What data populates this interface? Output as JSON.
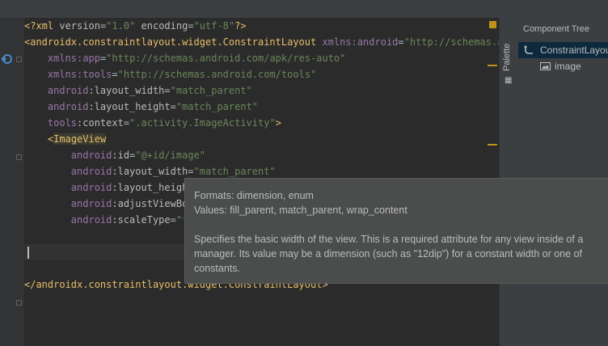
{
  "editor": {
    "lines": [
      [
        {
          "c": "t-pi",
          "t": "<?xml "
        },
        {
          "c": "t-attr",
          "t": "version"
        },
        {
          "c": "t-txt",
          "t": "="
        },
        {
          "c": "t-val",
          "t": "\"1.0\""
        },
        {
          "c": "t-txt",
          "t": " "
        },
        {
          "c": "t-attr",
          "t": "encoding"
        },
        {
          "c": "t-txt",
          "t": "="
        },
        {
          "c": "t-val",
          "t": "\"utf-8\""
        },
        {
          "c": "t-pi",
          "t": "?>"
        }
      ],
      [
        {
          "c": "t-tag",
          "t": "<androidx.constraintlayout.widget.ConstraintLayout "
        },
        {
          "c": "t-ns",
          "t": "xmlns:android"
        },
        {
          "c": "t-txt",
          "t": "="
        },
        {
          "c": "t-val",
          "t": "\"http://schemas.and"
        }
      ],
      [
        {
          "c": "t-txt",
          "t": "    "
        },
        {
          "c": "t-ns",
          "t": "xmlns:app"
        },
        {
          "c": "t-txt",
          "t": "="
        },
        {
          "c": "t-val",
          "t": "\"http://schemas.android.com/apk/res-auto\""
        }
      ],
      [
        {
          "c": "t-txt",
          "t": "    "
        },
        {
          "c": "t-ns",
          "t": "xmlns:tools"
        },
        {
          "c": "t-txt",
          "t": "="
        },
        {
          "c": "t-val",
          "t": "\"http://schemas.android.com/tools\""
        }
      ],
      [
        {
          "c": "t-txt",
          "t": "    "
        },
        {
          "c": "t-ns",
          "t": "android"
        },
        {
          "c": "t-attr",
          "t": ":layout_width"
        },
        {
          "c": "t-txt",
          "t": "="
        },
        {
          "c": "t-val",
          "t": "\"match_parent\""
        }
      ],
      [
        {
          "c": "t-txt",
          "t": "    "
        },
        {
          "c": "t-ns",
          "t": "android"
        },
        {
          "c": "t-attr",
          "t": ":layout_height"
        },
        {
          "c": "t-txt",
          "t": "="
        },
        {
          "c": "t-val",
          "t": "\"match_parent\""
        }
      ],
      [
        {
          "c": "t-txt",
          "t": "    "
        },
        {
          "c": "t-ns",
          "t": "tools"
        },
        {
          "c": "t-attr",
          "t": ":context"
        },
        {
          "c": "t-txt",
          "t": "="
        },
        {
          "c": "t-val",
          "t": "\".activity.ImageActivity\""
        },
        {
          "c": "t-tag",
          "t": ">"
        }
      ],
      [
        {
          "c": "t-txt",
          "t": "    "
        },
        {
          "c": "t-tag",
          "t": "<"
        },
        {
          "c": "t-tag t-hl",
          "t": "ImageView"
        }
      ],
      [
        {
          "c": "t-txt",
          "t": "        "
        },
        {
          "c": "t-ns",
          "t": "android"
        },
        {
          "c": "t-attr",
          "t": ":id"
        },
        {
          "c": "t-txt",
          "t": "="
        },
        {
          "c": "t-val",
          "t": "\"@+id/image\""
        }
      ],
      [
        {
          "c": "t-txt",
          "t": "        "
        },
        {
          "c": "t-ns",
          "t": "android"
        },
        {
          "c": "t-attr",
          "t": ":layout_width"
        },
        {
          "c": "t-txt",
          "t": "="
        },
        {
          "c": "t-val",
          "t": "\"match_parent\""
        }
      ],
      [
        {
          "c": "t-txt",
          "t": "        "
        },
        {
          "c": "t-ns",
          "t": "android"
        },
        {
          "c": "t-attr",
          "t": ":layout_heigh"
        }
      ],
      [
        {
          "c": "t-txt",
          "t": "        "
        },
        {
          "c": "t-ns",
          "t": "android"
        },
        {
          "c": "t-attr",
          "t": ":adjustViewBo"
        }
      ],
      [
        {
          "c": "t-txt",
          "t": "        "
        },
        {
          "c": "t-ns",
          "t": "android"
        },
        {
          "c": "t-attr",
          "t": ":scaleType"
        },
        {
          "c": "t-txt",
          "t": "="
        },
        {
          "c": "t-val",
          "t": "\"f"
        }
      ],
      [],
      [],
      [],
      [
        {
          "c": "t-tag",
          "t": "</androidx.constraintlayout.widget.ConstraintLayout>"
        }
      ]
    ]
  },
  "side_strip": {
    "label": "Palette",
    "icon": "palette-icon"
  },
  "component_tree": {
    "title": "Component Tree",
    "items": [
      {
        "label": "ConstraintLayout",
        "icon": "constraint-layout-icon",
        "selected": true
      },
      {
        "label": "image",
        "icon": "image-icon",
        "selected": false
      }
    ]
  },
  "tooltip": {
    "formats": "Formats: dimension, enum",
    "values": "Values: fill_parent, match_parent, wrap_content",
    "desc_1": "Specifies the basic width of the view. This is a required attribute for any view inside of a",
    "desc_2": "manager. Its value may be a dimension (such as \"12dip\") for a constant width or one of",
    "desc_3": "constants."
  },
  "colors": {
    "accent_marker": "#be9117",
    "selection": "#0d293e"
  }
}
